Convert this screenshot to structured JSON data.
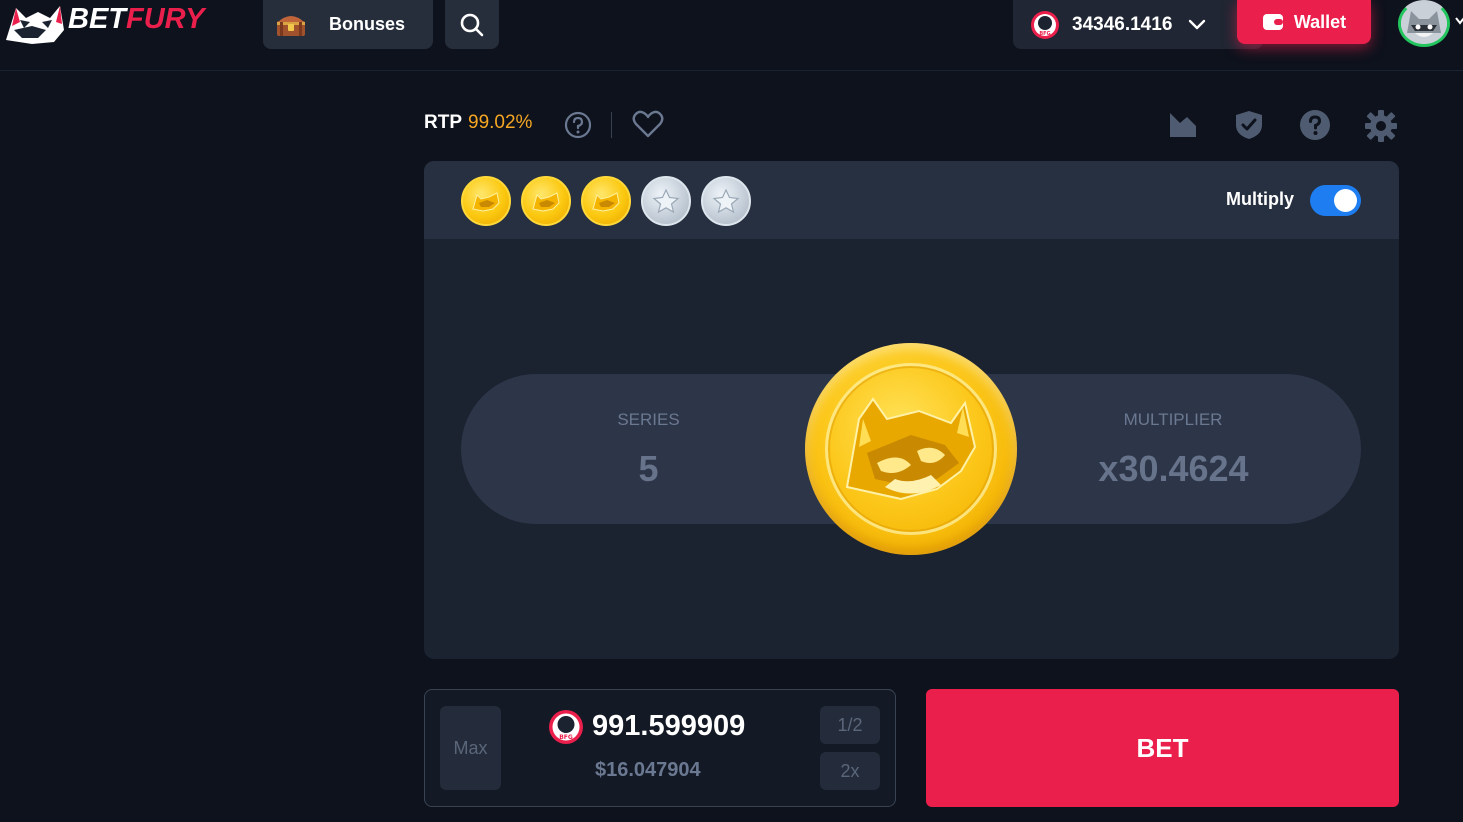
{
  "header": {
    "logo": {
      "bet": "BET",
      "fury": "FURY"
    },
    "bonuses_label": "Bonuses",
    "balance": "34346.1416",
    "balance_coin_text": "BFG",
    "wallet_label": "Wallet"
  },
  "toolbar": {
    "rtp_key": "RTP",
    "rtp_value": "99.02%",
    "icons": [
      "help-icon",
      "heart-icon",
      "stats-chart-icon",
      "fairness-shield-icon",
      "rules-help-icon",
      "settings-gear-icon"
    ]
  },
  "game": {
    "history": [
      "gold",
      "gold",
      "gold",
      "silver",
      "silver"
    ],
    "multiply_label": "Multiply",
    "multiply_on": true,
    "series_label": "SERIES",
    "series_value": "5",
    "multiplier_label": "MULTIPLIER",
    "multiplier_value": "x30.4624"
  },
  "bet": {
    "max_label": "Max",
    "amount": "991.599909",
    "usd": "$16.047904",
    "half_label": "1/2",
    "double_label": "2x",
    "bet_label": "BET",
    "coin_text": "BFG"
  },
  "colors": {
    "background": "#0d121c",
    "accent_red": "#ea1f4b",
    "rtp_orange": "#f5a623",
    "toggle_blue": "#1e7ef1",
    "coin_gold": "#fcc71a"
  }
}
